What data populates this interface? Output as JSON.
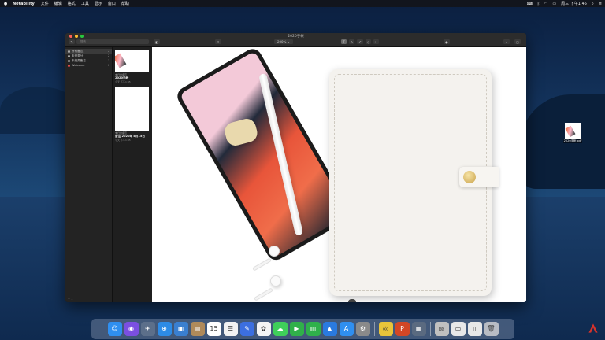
{
  "menubar": {
    "app_name": "Notability",
    "items": [
      "文件",
      "编辑",
      "格式",
      "工具",
      "显示",
      "窗口",
      "帮助"
    ],
    "clock": "周三 下午1:45"
  },
  "window": {
    "title": "2020手帐",
    "search_placeholder": "搜索",
    "zoom": "200% ⌄"
  },
  "sidebar": {
    "items": [
      {
        "label": "所有备忘",
        "count": "2"
      },
      {
        "label": "未归类分",
        "count": "2"
      },
      {
        "label": "未归类备忘",
        "count": "1"
      },
      {
        "label": "Welcome",
        "count": "0"
      }
    ],
    "footer": "+ ⌄"
  },
  "notes": [
    {
      "category": "未归类备忘",
      "title": "2020手帐",
      "meta": "今天 下午1:45"
    },
    {
      "category": "未归类备忘",
      "title": "备注 2020年 4月15日",
      "meta": "今天 下午1:45"
    }
  ],
  "desktop_file": {
    "name": "2020手帐.pdf"
  },
  "dock": {
    "icons": [
      {
        "name": "finder-icon",
        "glyph": "☺",
        "color": "#2f8ff0"
      },
      {
        "name": "siri-icon",
        "glyph": "◉",
        "color": "#7b4fe0"
      },
      {
        "name": "launchpad-icon",
        "glyph": "✈",
        "color": "#5c6f8a"
      },
      {
        "name": "safari-icon",
        "glyph": "⊕",
        "color": "#2d8be6"
      },
      {
        "name": "preview-icon",
        "glyph": "▣",
        "color": "#3a7fd0"
      },
      {
        "name": "contacts-icon",
        "glyph": "▤",
        "color": "#b08a5a"
      },
      {
        "name": "calendar-icon",
        "glyph": "15",
        "color": "#ffffff"
      },
      {
        "name": "reminders-icon",
        "glyph": "☰",
        "color": "#f2f2f2"
      },
      {
        "name": "notability-icon",
        "glyph": "✎",
        "color": "#3c6fe0"
      },
      {
        "name": "photos-icon",
        "glyph": "✿",
        "color": "#f5f5f5"
      },
      {
        "name": "messages-icon",
        "glyph": "☁",
        "color": "#3fcf5a"
      },
      {
        "name": "facetime-icon",
        "glyph": "▶",
        "color": "#30b04a"
      },
      {
        "name": "numbers-icon",
        "glyph": "▥",
        "color": "#2fb04b"
      },
      {
        "name": "keynote-icon",
        "glyph": "▲",
        "color": "#2a7ae0"
      },
      {
        "name": "appstore-icon",
        "glyph": "A",
        "color": "#2f8ff0"
      },
      {
        "name": "system-prefs-icon",
        "glyph": "⚙",
        "color": "#8a8a8a"
      },
      {
        "name": "chrome-icon",
        "glyph": "◎",
        "color": "#e8c43a"
      },
      {
        "name": "powerpoint-icon",
        "glyph": "P",
        "color": "#d24726"
      },
      {
        "name": "screen-icon",
        "glyph": "▦",
        "color": "#5a6a80"
      },
      {
        "name": "archive-icon",
        "glyph": "▧",
        "color": "#c0c0c0"
      },
      {
        "name": "window-icon",
        "glyph": "▭",
        "color": "#e8e8e8"
      },
      {
        "name": "doc-icon",
        "glyph": "▯",
        "color": "#e8e8e8"
      },
      {
        "name": "trash-icon",
        "glyph": "🗑",
        "color": "#b8bcc4"
      }
    ]
  }
}
